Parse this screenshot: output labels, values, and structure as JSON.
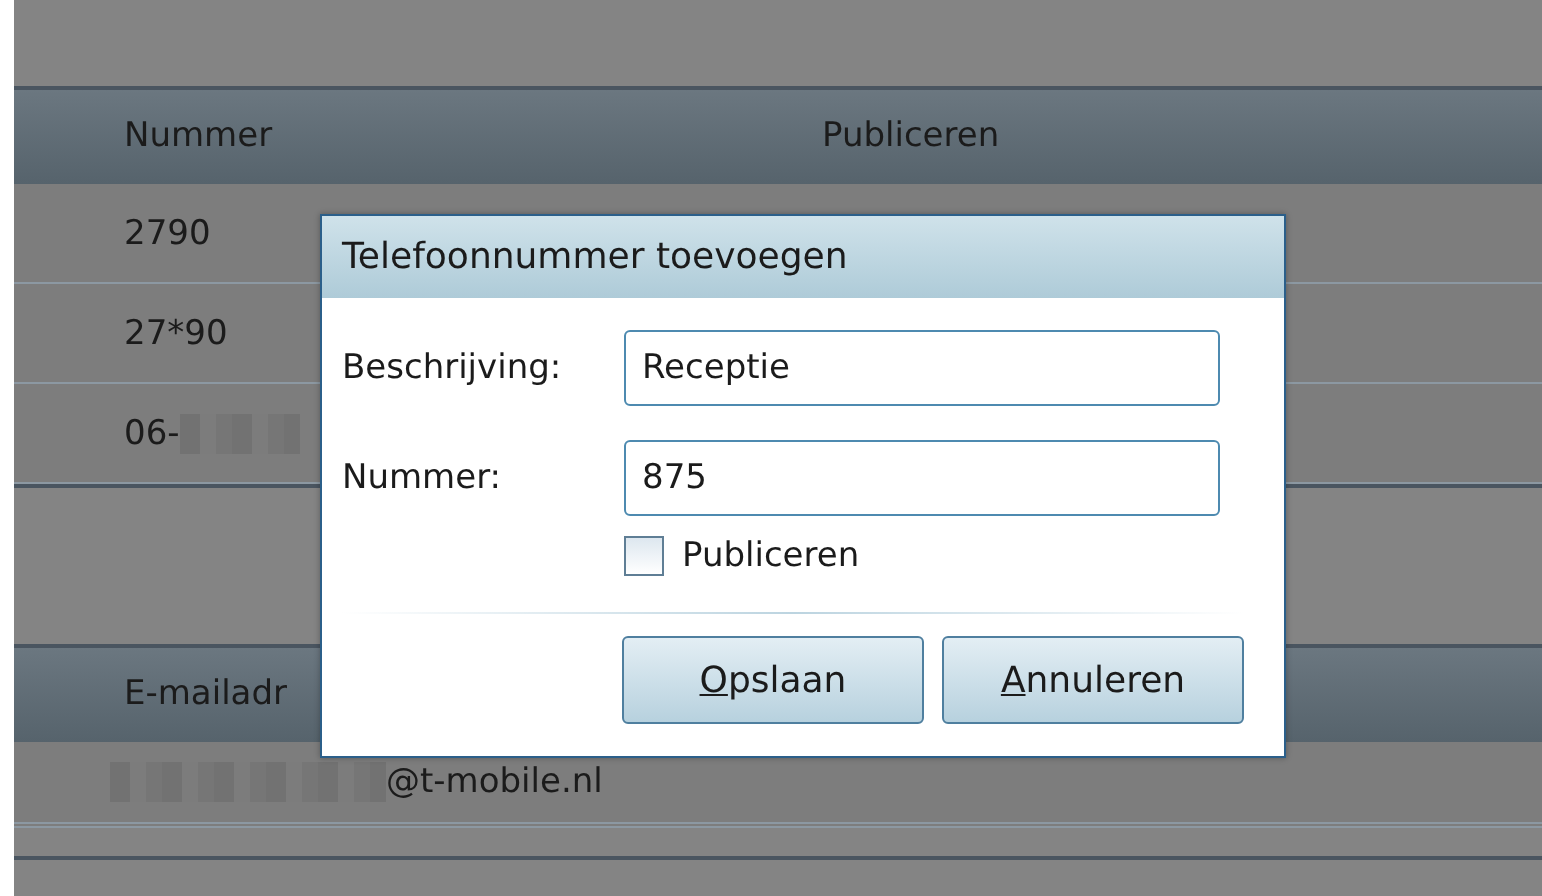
{
  "phone_table": {
    "columns": [
      "Nummer",
      "Publiceren"
    ],
    "rows": [
      {
        "number": "2790",
        "redacted": false
      },
      {
        "number": "27*90",
        "redacted": false
      },
      {
        "number": "06-",
        "redacted": true
      }
    ]
  },
  "email_table": {
    "columns": [
      "E-mailadr"
    ],
    "rows": [
      {
        "address": "@t-mobile.nl",
        "redacted": true
      }
    ]
  },
  "dialog": {
    "title": "Telefoonnummer toevoegen",
    "fields": [
      {
        "label": "Beschrijving:",
        "value": "Receptie"
      },
      {
        "label": "Nummer:",
        "value": "875"
      }
    ],
    "checkbox": {
      "label": "Publiceren",
      "checked": false
    },
    "buttons": [
      {
        "mnemonic": "O",
        "rest": "pslaan"
      },
      {
        "mnemonic": "A",
        "rest": "nnuleren"
      }
    ]
  }
}
